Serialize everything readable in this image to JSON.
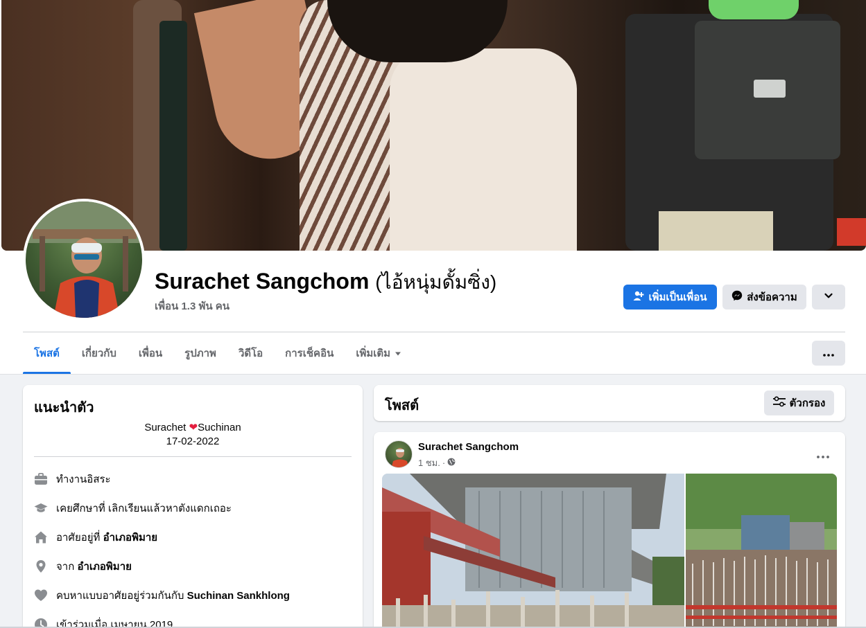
{
  "profile": {
    "name": "Surachet Sangchom",
    "alt_name": "(ไอ้หนุ่มดั้มซิ่ง)",
    "friends": "เพื่อน 1.3 พัน คน"
  },
  "actions": {
    "add_friend": "เพิ่มเป็นเพื่อน",
    "message": "ส่งข้อความ"
  },
  "tabs": [
    {
      "label": "โพสต์",
      "active": true
    },
    {
      "label": "เกี่ยวกับ"
    },
    {
      "label": "เพื่อน"
    },
    {
      "label": "รูปภาพ"
    },
    {
      "label": "วิดีโอ"
    },
    {
      "label": "การเช็คอิน"
    },
    {
      "label": "เพิ่มเติม"
    }
  ],
  "intro": {
    "title": "แนะนำตัว",
    "bio_name_left": "Surachet",
    "bio_name_right": "Suchinan",
    "bio_date": "17-02-2022",
    "rows": [
      {
        "icon": "briefcase-icon",
        "text": "ทำงานอิสระ",
        "strong": ""
      },
      {
        "icon": "graduation-cap-icon",
        "text": "เคยศึกษาที่ เลิกเรียนแล้วหาตังแดกเถอะ",
        "strong": ""
      },
      {
        "icon": "home-icon",
        "text": "อาศัยอยู่ที่ ",
        "strong": "อำเภอพิมาย"
      },
      {
        "icon": "location-pin-icon",
        "text": "จาก ",
        "strong": "อำเภอพิมาย"
      },
      {
        "icon": "heart-icon",
        "text": "คบหาแบบอาศัยอยู่ร่วมกันกับ ",
        "strong": "Suchinan Sankhlong"
      },
      {
        "icon": "clock-icon",
        "text": "เข้าร่วมเมื่อ เมษายน 2019",
        "strong": ""
      }
    ]
  },
  "posts": {
    "title": "โพสต์",
    "filter": "ตัวกรอง"
  },
  "post": {
    "author": "Surachet Sangchom",
    "time": "1 ชม.",
    "separator": "·"
  },
  "colors": {
    "accent": "#1b74e4",
    "heart": "#e41e3f"
  }
}
